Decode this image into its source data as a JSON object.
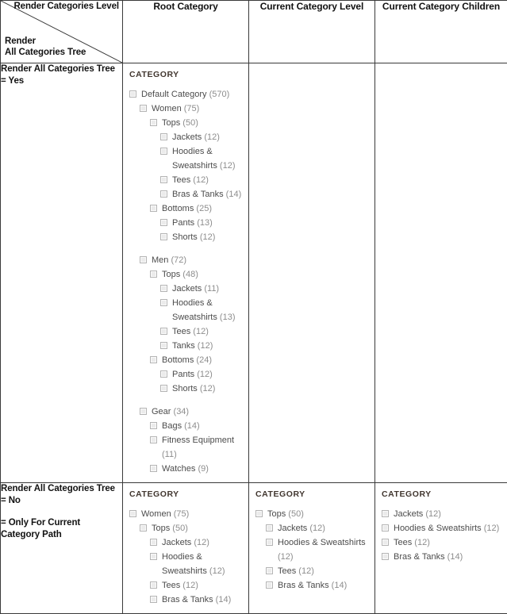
{
  "header": {
    "corner_top_label": "Render Categories Level",
    "corner_bottom_label_line1": "Render",
    "corner_bottom_label_line2": "All Categories Tree",
    "columns": [
      "Root Category",
      "Current Category Level",
      "Current Category Children"
    ]
  },
  "rows": [
    {
      "label_line1": "Render All Categories Tree",
      "label_line2": "= Yes",
      "label_line3": "",
      "label_line4": ""
    },
    {
      "label_line1": "Render All Categories Tree",
      "label_line2": "= No",
      "label_line3": "= Only For Current",
      "label_line4": "Category Path"
    }
  ],
  "widget_title": "CATEGORY",
  "colors": {
    "border": "#3a3a3a",
    "title_text": "#41362f",
    "node_text": "#4c4c4c",
    "count_text": "#8d8d8d",
    "checkbox_fill": "#ebebeb",
    "checkbox_border": "#b4b4b4"
  },
  "trees": {
    "yes_root_category": [
      {
        "depth": 0,
        "name": "Default Category",
        "count": "(570)",
        "spaced": false
      },
      {
        "depth": 1,
        "name": "Women",
        "count": "(75)",
        "spaced": false
      },
      {
        "depth": 2,
        "name": "Tops",
        "count": "(50)",
        "spaced": false
      },
      {
        "depth": 3,
        "name": "Jackets",
        "count": "(12)",
        "spaced": false
      },
      {
        "depth": 3,
        "name": "Hoodies & Sweatshirts",
        "count": "(12)",
        "spaced": false
      },
      {
        "depth": 3,
        "name": "Tees",
        "count": "(12)",
        "spaced": false
      },
      {
        "depth": 3,
        "name": "Bras & Tanks",
        "count": "(14)",
        "spaced": false
      },
      {
        "depth": 2,
        "name": "Bottoms",
        "count": "(25)",
        "spaced": false
      },
      {
        "depth": 3,
        "name": "Pants",
        "count": "(13)",
        "spaced": false
      },
      {
        "depth": 3,
        "name": "Shorts",
        "count": "(12)",
        "spaced": false
      },
      {
        "depth": 1,
        "name": "Men",
        "count": "(72)",
        "spaced": true
      },
      {
        "depth": 2,
        "name": "Tops",
        "count": "(48)",
        "spaced": false
      },
      {
        "depth": 3,
        "name": "Jackets",
        "count": "(11)",
        "spaced": false
      },
      {
        "depth": 3,
        "name": "Hoodies & Sweatshirts",
        "count": "(13)",
        "spaced": false
      },
      {
        "depth": 3,
        "name": "Tees",
        "count": "(12)",
        "spaced": false
      },
      {
        "depth": 3,
        "name": "Tanks",
        "count": "(12)",
        "spaced": false
      },
      {
        "depth": 2,
        "name": "Bottoms",
        "count": "(24)",
        "spaced": false
      },
      {
        "depth": 3,
        "name": "Pants",
        "count": "(12)",
        "spaced": false
      },
      {
        "depth": 3,
        "name": "Shorts",
        "count": "(12)",
        "spaced": false
      },
      {
        "depth": 1,
        "name": "Gear",
        "count": "(34)",
        "spaced": true
      },
      {
        "depth": 2,
        "name": "Bags",
        "count": "(14)",
        "spaced": false
      },
      {
        "depth": 2,
        "name": "Fitness Equipment",
        "count": "(11)",
        "spaced": false
      },
      {
        "depth": 2,
        "name": "Watches",
        "count": "(9)",
        "spaced": false
      }
    ],
    "no_root_category": [
      {
        "depth": 0,
        "name": "Women",
        "count": "(75)",
        "spaced": false
      },
      {
        "depth": 1,
        "name": "Tops",
        "count": "(50)",
        "spaced": false
      },
      {
        "depth": 2,
        "name": "Jackets",
        "count": "(12)",
        "spaced": false
      },
      {
        "depth": 2,
        "name": "Hoodies & Sweatshirts",
        "count": "(12)",
        "spaced": false
      },
      {
        "depth": 2,
        "name": "Tees",
        "count": "(12)",
        "spaced": false
      },
      {
        "depth": 2,
        "name": "Bras & Tanks",
        "count": "(14)",
        "spaced": false
      }
    ],
    "no_current_level": [
      {
        "depth": 0,
        "name": "Tops",
        "count": "(50)",
        "spaced": false
      },
      {
        "depth": 1,
        "name": "Jackets",
        "count": "(12)",
        "spaced": false
      },
      {
        "depth": 1,
        "name": "Hoodies & Sweatshirts",
        "count": "(12)",
        "spaced": false
      },
      {
        "depth": 1,
        "name": "Tees",
        "count": "(12)",
        "spaced": false
      },
      {
        "depth": 1,
        "name": "Bras & Tanks",
        "count": "(14)",
        "spaced": false
      }
    ],
    "no_current_children": [
      {
        "depth": 0,
        "name": "Jackets",
        "count": "(12)",
        "spaced": false
      },
      {
        "depth": 0,
        "name": "Hoodies & Sweatshirts",
        "count": "(12)",
        "spaced": false
      },
      {
        "depth": 0,
        "name": "Tees",
        "count": "(12)",
        "spaced": false
      },
      {
        "depth": 0,
        "name": "Bras & Tanks",
        "count": "(14)",
        "spaced": false
      }
    ]
  }
}
